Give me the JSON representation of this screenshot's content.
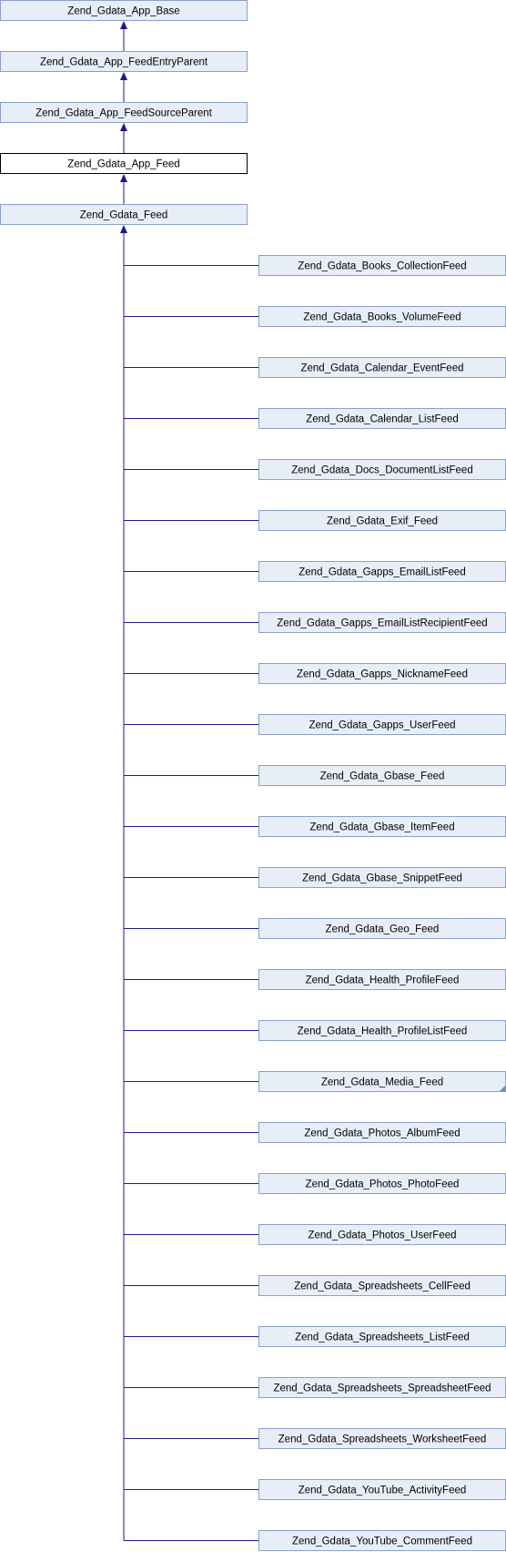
{
  "ancestors": [
    {
      "id": "n0",
      "label": "Zend_Gdata_App_Base"
    },
    {
      "id": "n1",
      "label": "Zend_Gdata_App_FeedEntryParent"
    },
    {
      "id": "n2",
      "label": "Zend_Gdata_App_FeedSourceParent"
    },
    {
      "id": "n3",
      "label": "Zend_Gdata_App_Feed",
      "current": true
    },
    {
      "id": "n4",
      "label": "Zend_Gdata_Feed"
    }
  ],
  "children": [
    {
      "label": "Zend_Gdata_Books_CollectionFeed"
    },
    {
      "label": "Zend_Gdata_Books_VolumeFeed"
    },
    {
      "label": "Zend_Gdata_Calendar_EventFeed"
    },
    {
      "label": "Zend_Gdata_Calendar_ListFeed"
    },
    {
      "label": "Zend_Gdata_Docs_DocumentListFeed"
    },
    {
      "label": "Zend_Gdata_Exif_Feed"
    },
    {
      "label": "Zend_Gdata_Gapps_EmailListFeed"
    },
    {
      "label": "Zend_Gdata_Gapps_EmailListRecipientFeed"
    },
    {
      "label": "Zend_Gdata_Gapps_NicknameFeed"
    },
    {
      "label": "Zend_Gdata_Gapps_UserFeed"
    },
    {
      "label": "Zend_Gdata_Gbase_Feed"
    },
    {
      "label": "Zend_Gdata_Gbase_ItemFeed"
    },
    {
      "label": "Zend_Gdata_Gbase_SnippetFeed"
    },
    {
      "label": "Zend_Gdata_Geo_Feed"
    },
    {
      "label": "Zend_Gdata_Health_ProfileFeed"
    },
    {
      "label": "Zend_Gdata_Health_ProfileListFeed"
    },
    {
      "label": "Zend_Gdata_Media_Feed",
      "has_more": true
    },
    {
      "label": "Zend_Gdata_Photos_AlbumFeed"
    },
    {
      "label": "Zend_Gdata_Photos_PhotoFeed"
    },
    {
      "label": "Zend_Gdata_Photos_UserFeed"
    },
    {
      "label": "Zend_Gdata_Spreadsheets_CellFeed"
    },
    {
      "label": "Zend_Gdata_Spreadsheets_ListFeed"
    },
    {
      "label": "Zend_Gdata_Spreadsheets_SpreadsheetFeed"
    },
    {
      "label": "Zend_Gdata_Spreadsheets_WorksheetFeed"
    },
    {
      "label": "Zend_Gdata_YouTube_ActivityFeed"
    },
    {
      "label": "Zend_Gdata_YouTube_CommentFeed"
    }
  ],
  "colors": {
    "node_fill": "#e8eef8",
    "node_border": "#8ca0cc",
    "current_fill": "#ffffff",
    "current_border": "#000000",
    "edge": "#1a1a8c"
  }
}
